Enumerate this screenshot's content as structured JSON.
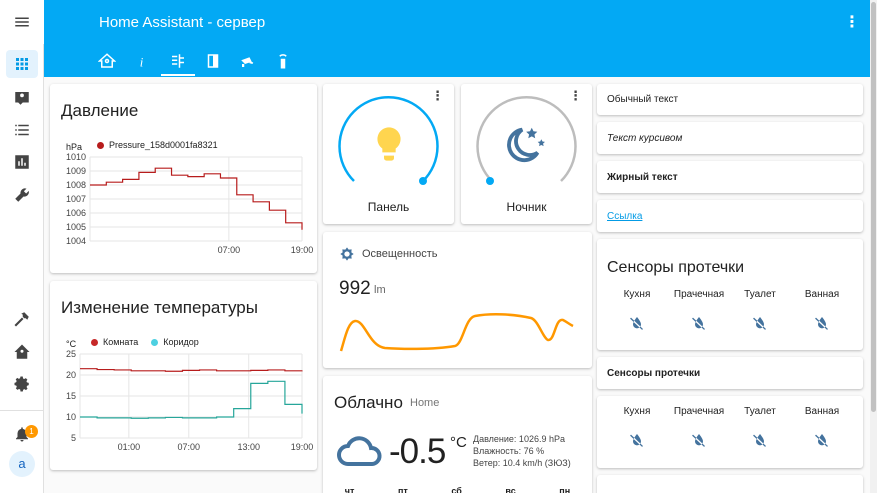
{
  "header": {
    "title": "Home Assistant - сервер",
    "tabs": [
      "home-icon",
      "info-icon",
      "automation-icon",
      "door-icon",
      "camera-icon",
      "remote-icon"
    ]
  },
  "sidebar": {
    "notifications_count": "1",
    "user_initial": "a"
  },
  "pressure": {
    "title": "Давление",
    "unit": "hPa",
    "legend": "Pressure_158d0001fa8321"
  },
  "temperature": {
    "title": "Изменение температуры",
    "unit": "°C",
    "legend_room": "Комната",
    "legend_corridor": "Коридор"
  },
  "lights": {
    "panel_label": "Панель",
    "night_label": "Ночник"
  },
  "illuminance": {
    "title": "Освещенность",
    "value": "992",
    "unit": "lm"
  },
  "weather": {
    "condition": "Облачно",
    "location": "Home",
    "temperature": "-0.5",
    "temp_unit": "°C",
    "pressure": "Давление: 1026.9 hPa",
    "humidity": "Влажность: 76 %",
    "wind": "Ветер: 10.4 km/h (ЗЮЗ)",
    "days": [
      "чт",
      "пт",
      "сб",
      "вс",
      "пн"
    ]
  },
  "markdown": {
    "plain": "Обычный текст",
    "italic": "Текст курсивом",
    "bold": "Жирный текст",
    "link": "Ссылка"
  },
  "leaks": {
    "title": "Сенсоры протечки",
    "title2": "Сенсоры протечки",
    "rooms": [
      "Кухня",
      "Прачечная",
      "Туалет",
      "Ванная"
    ]
  },
  "colors": {
    "primary": "#03a9f4",
    "pressure_line": "#b71c1c",
    "room_line": "#b71c1c",
    "corridor_line": "#26a69a",
    "lux_line": "#ff9800",
    "light_on": "#ffd54f",
    "light_off": "#44739e"
  },
  "chart_data": [
    {
      "type": "line",
      "title": "Давление",
      "ylabel": "hPa",
      "ylim": [
        1004,
        1010
      ],
      "yticks": [
        "1010",
        "1009",
        "1008",
        "1007",
        "1006",
        "1005",
        "1004"
      ],
      "xticks": [
        "07:00",
        "19:00"
      ],
      "series": [
        {
          "name": "Pressure_158d0001fa8321",
          "values": [
            1008.0,
            1008.2,
            1008.4,
            1008.9,
            1009.2,
            1008.7,
            1008.6,
            1008.8,
            1008.5,
            1007.3,
            1006.8,
            1006.2,
            1005.3,
            1004.8
          ]
        }
      ]
    },
    {
      "type": "line",
      "title": "Изменение температуры",
      "ylabel": "°C",
      "ylim": [
        5,
        25
      ],
      "yticks": [
        "25",
        "20",
        "15",
        "10",
        "5"
      ],
      "xticks": [
        "01:00",
        "07:00",
        "13:00",
        "19:00"
      ],
      "series": [
        {
          "name": "Комната",
          "values": [
            21.5,
            21.3,
            21.2,
            21.0,
            21.0,
            20.9,
            21.1,
            21.2,
            21.0,
            21.0,
            21.1,
            21.2,
            21.0,
            21.1
          ]
        },
        {
          "name": "Коридор",
          "values": [
            10.0,
            9.8,
            9.8,
            9.7,
            9.8,
            9.9,
            9.8,
            9.8,
            10.0,
            12.0,
            18.0,
            18.5,
            13.0,
            10.8
          ]
        }
      ]
    }
  ]
}
